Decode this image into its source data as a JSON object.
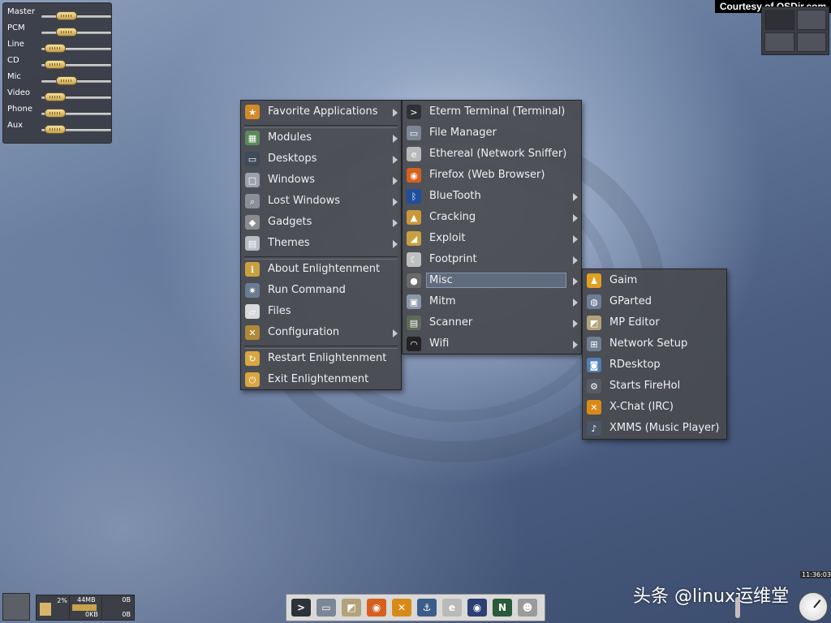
{
  "courtesy": "Courtesy of OSDir.com",
  "watermark": "头条 @linux运维堂",
  "clock": {
    "time": "11:36:03"
  },
  "mixer": {
    "channels": [
      {
        "label": "Master",
        "level": 0.36
      },
      {
        "label": "PCM",
        "level": 0.36
      },
      {
        "label": "Line",
        "level": 0.2
      },
      {
        "label": "CD",
        "level": 0.2
      },
      {
        "label": "Mic",
        "level": 0.36
      },
      {
        "label": "Video",
        "level": 0.2
      },
      {
        "label": "Phone",
        "level": 0.2
      },
      {
        "label": "Aux",
        "level": 0.2
      }
    ]
  },
  "main_menu": {
    "items": [
      {
        "label": "Favorite Applications",
        "icon": "favorites-icon",
        "submenu": true
      },
      {
        "label": "Modules",
        "icon": "modules-icon",
        "submenu": true
      },
      {
        "label": "Desktops",
        "icon": "desktops-icon",
        "submenu": true
      },
      {
        "label": "Windows",
        "icon": "windows-icon",
        "submenu": true
      },
      {
        "label": "Lost Windows",
        "icon": "lost-windows-icon",
        "submenu": true
      },
      {
        "label": "Gadgets",
        "icon": "gadgets-icon",
        "submenu": true
      },
      {
        "label": "Themes",
        "icon": "themes-icon",
        "submenu": true
      },
      {
        "label": "About Enlightenment",
        "icon": "about-icon",
        "submenu": false
      },
      {
        "label": "Run Command",
        "icon": "run-command-icon",
        "submenu": false
      },
      {
        "label": "Files",
        "icon": "files-icon",
        "submenu": false
      },
      {
        "label": "Configuration",
        "icon": "configuration-icon",
        "submenu": true
      },
      {
        "label": "Restart Enlightenment",
        "icon": "restart-icon",
        "submenu": false
      },
      {
        "label": "Exit Enlightenment",
        "icon": "exit-icon",
        "submenu": false
      }
    ]
  },
  "favorites_menu": {
    "items": [
      {
        "label": "Eterm Terminal (Terminal)",
        "icon": "terminal-icon",
        "submenu": false
      },
      {
        "label": "File Manager",
        "icon": "file-manager-icon",
        "submenu": false
      },
      {
        "label": "Ethereal (Network Sniffer)",
        "icon": "ethereal-icon",
        "submenu": false
      },
      {
        "label": "Firefox (Web Browser)",
        "icon": "firefox-icon",
        "submenu": false
      },
      {
        "label": "BlueTooth",
        "icon": "bluetooth-icon",
        "submenu": true
      },
      {
        "label": "Cracking",
        "icon": "cracking-icon",
        "submenu": true
      },
      {
        "label": "Exploit",
        "icon": "exploit-icon",
        "submenu": true
      },
      {
        "label": "Footprint",
        "icon": "footprint-icon",
        "submenu": true
      },
      {
        "label": "Misc",
        "icon": "misc-icon",
        "submenu": true,
        "selected": true
      },
      {
        "label": "Mitm",
        "icon": "mitm-icon",
        "submenu": true
      },
      {
        "label": "Scanner",
        "icon": "scanner-icon",
        "submenu": true
      },
      {
        "label": "Wifi",
        "icon": "wifi-icon",
        "submenu": true
      }
    ]
  },
  "misc_menu": {
    "items": [
      {
        "label": "Gaim",
        "icon": "gaim-icon"
      },
      {
        "label": "GParted",
        "icon": "gparted-icon"
      },
      {
        "label": "MP Editor",
        "icon": "mp-editor-icon"
      },
      {
        "label": "Network Setup",
        "icon": "network-setup-icon"
      },
      {
        "label": "RDesktop",
        "icon": "rdesktop-icon"
      },
      {
        "label": "Starts FireHol",
        "icon": "firehol-icon"
      },
      {
        "label": "X-Chat (IRC)",
        "icon": "xchat-icon"
      },
      {
        "label": "XMMS (Music Player)",
        "icon": "xmms-icon"
      }
    ]
  },
  "system_monitor": {
    "cpu": "2%",
    "mem_top": "44MB",
    "mem_bottom": "0KB",
    "net_top": "0B",
    "net_bottom": "0B"
  },
  "launcher": {
    "items": [
      {
        "icon": "terminal-icon"
      },
      {
        "icon": "file-manager-icon"
      },
      {
        "icon": "mp-editor-icon"
      },
      {
        "icon": "firefox-icon"
      },
      {
        "icon": "xchat-icon"
      },
      {
        "icon": "network-tool-icon"
      },
      {
        "icon": "ethereal-icon"
      },
      {
        "icon": "eye-icon"
      },
      {
        "icon": "network-map-icon"
      },
      {
        "icon": "kismet-icon"
      }
    ]
  }
}
